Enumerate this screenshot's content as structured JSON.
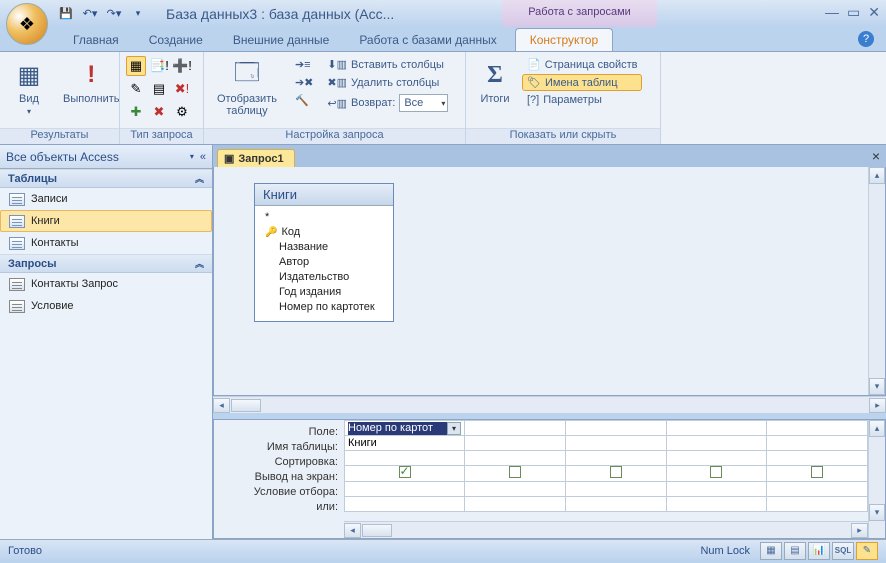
{
  "title": "База данных3 : база данных (Acc...",
  "contextual_tab_group": "Работа с запросами",
  "tabs": [
    "Главная",
    "Создание",
    "Внешние данные",
    "Работа с базами данных",
    "Конструктор"
  ],
  "active_tab": 4,
  "ribbon": {
    "group1": {
      "label": "Результаты",
      "view": "Вид",
      "run": "Выполнить"
    },
    "group2": {
      "label": "Тип запроса"
    },
    "group3": {
      "label": "Настройка запроса",
      "show_table": "Отобразить\nтаблицу",
      "insert_cols": "Вставить столбцы",
      "delete_cols": "Удалить столбцы",
      "return": "Возврат:",
      "return_value": "Все"
    },
    "group4": {
      "label": "Показать или скрыть",
      "totals": "Итоги",
      "prop_page": "Страница свойств",
      "table_names": "Имена таблиц",
      "params": "Параметры"
    }
  },
  "nav": {
    "header": "Все объекты Access",
    "sections": [
      {
        "title": "Таблицы",
        "items": [
          "Записи",
          "Книги",
          "Контакты"
        ],
        "selected": 1,
        "type": "table"
      },
      {
        "title": "Запросы",
        "items": [
          "Контакты Запрос",
          "Условие"
        ],
        "selected": -1,
        "type": "query"
      }
    ]
  },
  "doc_tab": "Запрос1",
  "table_box": {
    "title": "Книги",
    "star": "*",
    "fields": [
      "Код",
      "Название",
      "Автор",
      "Издательство",
      "Год издания",
      "Номер по картотек"
    ],
    "key_index": 0
  },
  "grid": {
    "labels": [
      "Поле:",
      "Имя таблицы:",
      "Сортировка:",
      "Вывод на экран:",
      "Условие отбора:",
      "или:"
    ],
    "col1_field": "Номер по картот",
    "col1_table": "Книги"
  },
  "status": {
    "ready": "Готово",
    "numlock": "Num Lock",
    "sql": "SQL"
  }
}
